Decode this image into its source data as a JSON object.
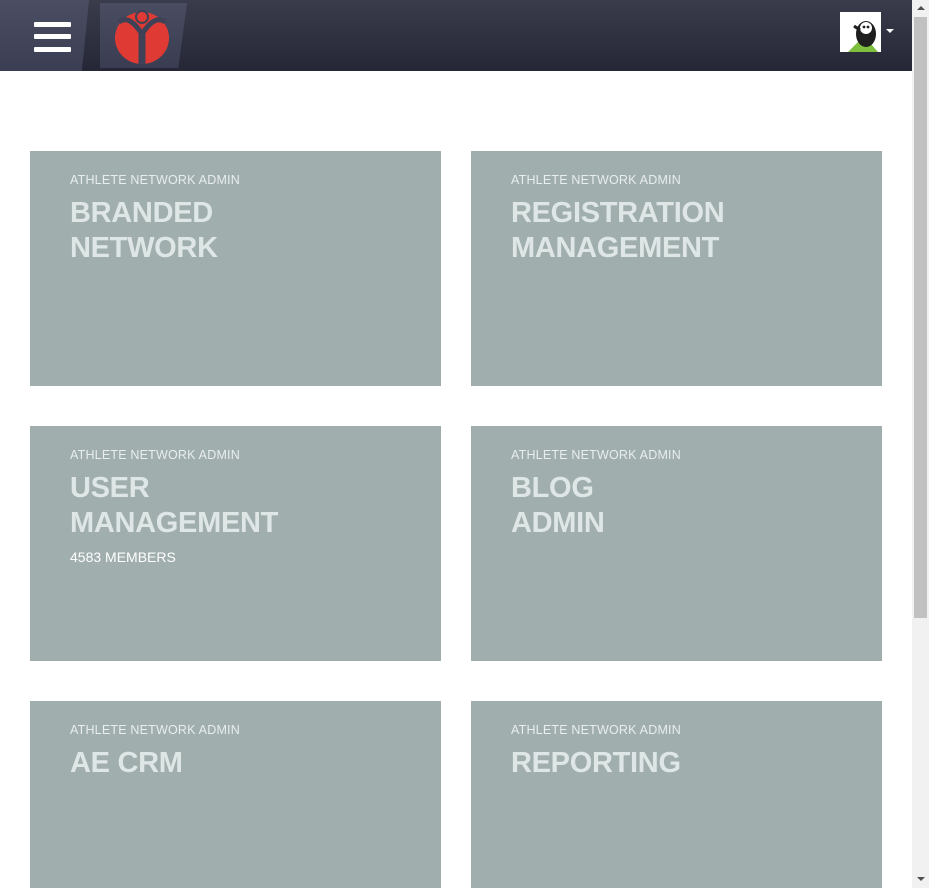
{
  "header": {
    "menu_icon": "hamburger-menu-icon",
    "logo_icon": "athlete-network-logo-icon",
    "avatar_icon": "user-avatar-icon",
    "dropdown_icon": "caret-down-icon",
    "background_color": "#2c2e3e",
    "logo_color": "#e03a35"
  },
  "tiles": [
    {
      "eyebrow": "ATHLETE NETWORK ADMIN",
      "title": "BRANDED\nNETWORK",
      "subtitle": ""
    },
    {
      "eyebrow": "ATHLETE NETWORK ADMIN",
      "title": "REGISTRATION\nMANAGEMENT",
      "subtitle": ""
    },
    {
      "eyebrow": "ATHLETE NETWORK ADMIN",
      "title": "USER\nMANAGEMENT",
      "subtitle": "4583 MEMBERS"
    },
    {
      "eyebrow": "ATHLETE NETWORK ADMIN",
      "title": "BLOG\nADMIN",
      "subtitle": ""
    },
    {
      "eyebrow": "ATHLETE NETWORK ADMIN",
      "title": "AE CRM",
      "subtitle": ""
    },
    {
      "eyebrow": "ATHLETE NETWORK ADMIN",
      "title": "REPORTING",
      "subtitle": ""
    }
  ],
  "colors": {
    "tile_background": "#a1aeae",
    "tile_text": "#dfe6e6"
  }
}
